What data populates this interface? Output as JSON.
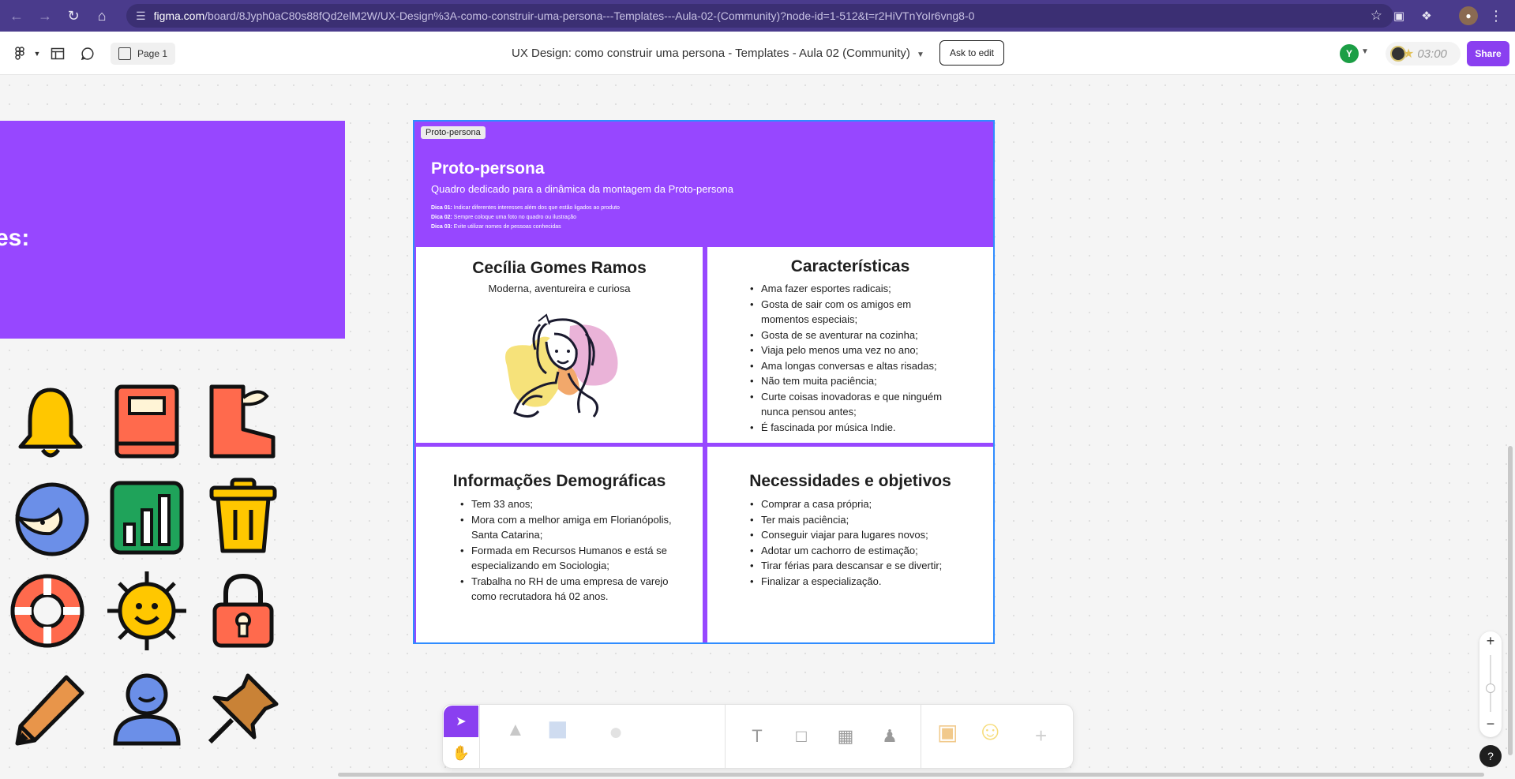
{
  "browser": {
    "url_host": "figma.com",
    "url_path": "/board/8Jyph0aC80s88fQd2elM2W/UX-Design%3A-como-construir-uma-persona---Templates---Aula-02-(Community)?node-id=1-512&t=r2HiVTnYoIr6vng8-0"
  },
  "toolbar": {
    "page_label": "Page 1",
    "file_title": "UX Design: como construir uma persona - Templates - Aula 02 (Community)",
    "ask_to_edit": "Ask to edit",
    "avatar_initial": "Y",
    "timer": "03:00",
    "share": "Share"
  },
  "canvas": {
    "left_frame_text": "es:"
  },
  "frame": {
    "label": "Proto-persona",
    "title": "Proto-persona",
    "subtitle": "Quadro dedicado para a dinâmica da montagem da Proto-persona",
    "tips": [
      {
        "key": "Dica 01:",
        "text": " Indicar diferentes interesses além dos que estão ligados ao produto"
      },
      {
        "key": "Dica 02:",
        "text": " Sempre coloque uma foto no quadro ou ilustração"
      },
      {
        "key": "Dica 03:",
        "text": " Evite utilizar nomes de pessoas conhecidas"
      }
    ],
    "persona": {
      "name": "Cecília Gomes Ramos",
      "tagline": "Moderna, aventureira e curiosa"
    },
    "caracteristicas": {
      "title": "Características",
      "items": [
        "Ama fazer esportes radicais;",
        "Gosta de sair com os amigos em momentos especiais;",
        "Gosta de se aventurar na cozinha;",
        "Viaja pelo menos uma vez no ano;",
        "Ama longas conversas e altas risadas;",
        "Não tem muita paciência;",
        "Curte coisas inovadoras e que ninguém nunca pensou antes;",
        "É fascinada por música Indie."
      ]
    },
    "demograficas": {
      "title": "Informações Demográficas",
      "items": [
        "Tem 33 anos;",
        "Mora com a melhor amiga em Florianópolis, Santa Catarina;",
        "Formada em Recursos Humanos e está se especializando em Sociologia;",
        "Trabalha no RH de uma empresa de varejo como recrutadora há 02 anos."
      ]
    },
    "necessidades": {
      "title": "Necessidades e objetivos",
      "items": [
        "Comprar a casa própria;",
        "Ter mais paciência;",
        "Conseguir viajar para lugares novos;",
        "Adotar um cachorro de estimação;",
        "Tirar férias para descansar e se divertir;",
        "Finalizar a especialização."
      ]
    }
  },
  "zoom": {
    "plus": "+",
    "minus": "−"
  },
  "help": "?",
  "colors": {
    "brand_purple": "#9747ff",
    "share_purple": "#8a3ff0",
    "selection_blue": "#2f8cff",
    "browser_bar": "#4a3b8c"
  }
}
